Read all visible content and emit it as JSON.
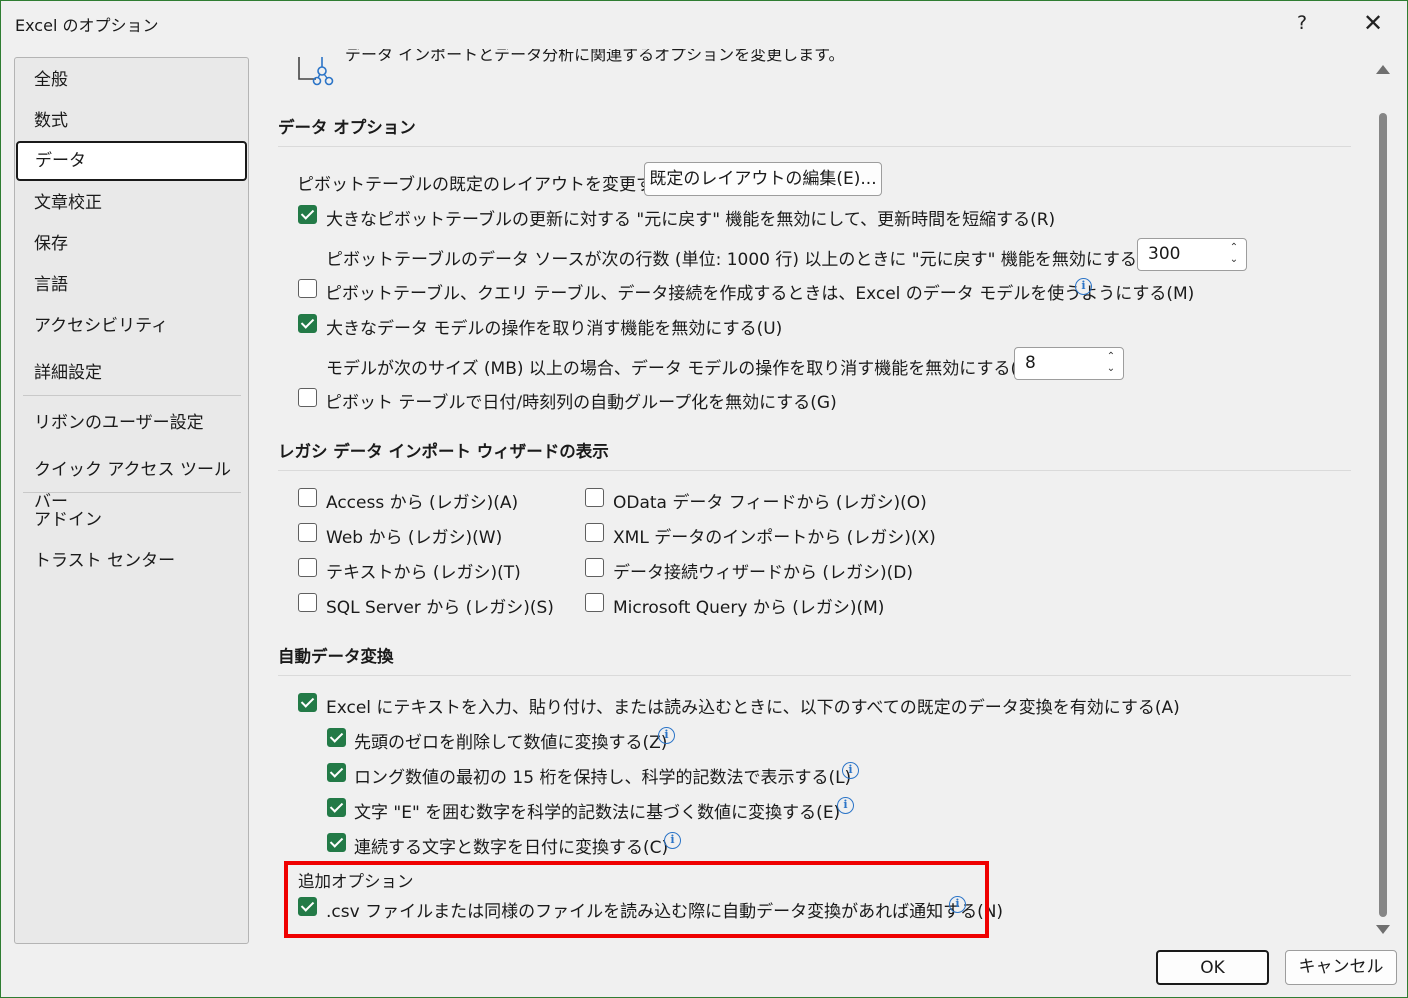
{
  "window": {
    "title": "Excel のオプション",
    "help_label": "?",
    "close_label": "✕"
  },
  "sidebar": {
    "items": [
      {
        "label": "全般"
      },
      {
        "label": "数式"
      },
      {
        "label": "データ"
      },
      {
        "label": "文章校正"
      },
      {
        "label": "保存"
      },
      {
        "label": "言語"
      },
      {
        "label": "アクセシビリティ"
      },
      {
        "label": "詳細設定"
      },
      {
        "label": "リボンのユーザー設定"
      },
      {
        "label": "クイック アクセス ツール バー"
      },
      {
        "label": "アドイン"
      },
      {
        "label": "トラスト センター"
      }
    ],
    "selected": "データ"
  },
  "intro": {
    "text": "データ インポートとデータ分析に関連するオプションを変更します。"
  },
  "data_options": {
    "heading": "データ オプション",
    "pivot_layout_label": "ピボットテーブルの既定のレイアウトを変更する:",
    "pivot_layout_button": "既定のレイアウトの編集(E)...",
    "disable_undo_large_pivot": {
      "label": "大きなピボットテーブルの更新に対する \"元に戻す\" 機能を無効にして、更新時間を短縮する(R)",
      "checked": true
    },
    "pivot_rows_threshold": {
      "label": "ピボットテーブルのデータ ソースが次の行数 (単位: 1000 行) 以上のときに \"元に戻す\" 機能を無効にする(N):",
      "value": "300"
    },
    "use_data_model": {
      "label": "ピボットテーブル、クエリ テーブル、データ接続を作成するときは、Excel のデータ モデルを使うようにする(M)",
      "checked": false
    },
    "disable_undo_data_model": {
      "label": "大きなデータ モデルの操作を取り消す機能を無効にする(U)",
      "checked": true
    },
    "model_size_threshold": {
      "label": "モデルが次のサイズ (MB) 以上の場合、データ モデルの操作を取り消す機能を無効にする(L):",
      "value": "8"
    },
    "disable_auto_grouping": {
      "label": "ピボット テーブルで日付/時刻列の自動グループ化を無効にする(G)",
      "checked": false
    }
  },
  "legacy_wizards": {
    "heading": "レガシ データ インポート ウィザードの表示",
    "left": [
      {
        "label": "Access から (レガシ)(A)",
        "checked": false
      },
      {
        "label": "Web から (レガシ)(W)",
        "checked": false
      },
      {
        "label": "テキストから (レガシ)(T)",
        "checked": false
      },
      {
        "label": "SQL Server から (レガシ)(S)",
        "checked": false
      }
    ],
    "right": [
      {
        "label": "OData データ フィードから (レガシ)(O)",
        "checked": false
      },
      {
        "label": "XML データのインポートから (レガシ)(X)",
        "checked": false
      },
      {
        "label": "データ接続ウィザードから (レガシ)(D)",
        "checked": false
      },
      {
        "label": "Microsoft Query から (レガシ)(M)",
        "checked": false
      }
    ]
  },
  "auto_conversion": {
    "heading": "自動データ変換",
    "enable_all": {
      "label": "Excel にテキストを入力、貼り付け、または読み込むときに、以下のすべての既定のデータ変換を有効にする(A)",
      "checked": true
    },
    "sub_options": [
      {
        "label": "先頭のゼロを削除して数値に変換する(Z)",
        "checked": true
      },
      {
        "label": "ロング数値の最初の 15 桁を保持し、科学的記数法で表示する(L)",
        "checked": true
      },
      {
        "label": "文字 \"E\" を囲む数字を科学的記数法に基づく数値に変換する(E)",
        "checked": true
      },
      {
        "label": "連続する文字と数字を日付に変換する(C)",
        "checked": true
      }
    ],
    "additional_heading": "追加オプション",
    "notify_csv": {
      "label": ".csv ファイルまたは同様のファイルを読み込む際に自動データ変換があれば通知する(N)",
      "checked": true
    }
  },
  "footer": {
    "ok_label": "OK",
    "cancel_label": "キャンセル"
  },
  "info_glyph": "i",
  "colors": {
    "accent_green": "#237a47",
    "highlight_red": "#ef0000",
    "info_blue": "#2b74c7"
  }
}
